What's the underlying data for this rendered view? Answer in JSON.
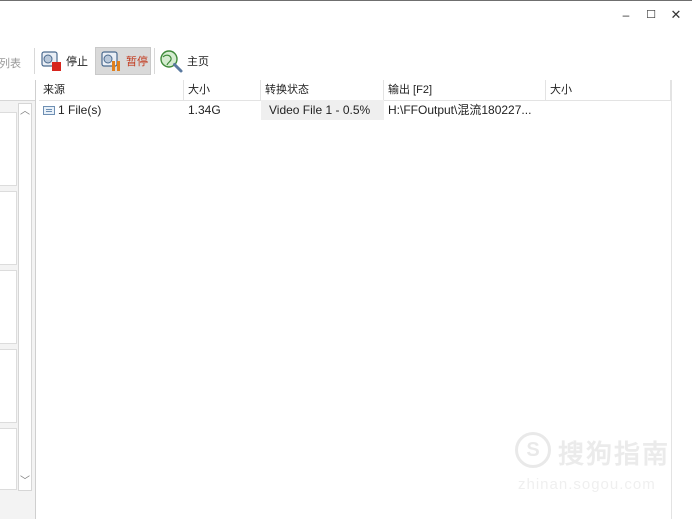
{
  "window": {
    "minimize_glyph": "–",
    "maximize_glyph": "☐",
    "close_glyph": "✕"
  },
  "toolbar": {
    "clipped_label": "全列表",
    "stop_label": "停止",
    "pause_label": "暂停",
    "home_label": "主页",
    "icons": [
      "stop-icon",
      "pause-icon",
      "home-icon"
    ]
  },
  "table": {
    "columns": [
      "来源",
      "大小",
      "转换状态",
      "输出 [F2]",
      "大小"
    ],
    "rows": [
      {
        "source": "1 File(s)",
        "size": "1.34G",
        "status": "Video File 1 - 0.5%",
        "output": "H:\\FFOutput\\混流180227..."
      }
    ]
  },
  "scrollbar": {
    "up_glyph": "︿",
    "down_glyph": "﹀"
  },
  "watermark": {
    "title": "搜狗指南",
    "url": "zhinan.sogou.com",
    "logo_glyph": "S"
  },
  "colors": {
    "active_label": "#c23a1e",
    "border": "#d6d6d6",
    "status_cell_bg": "#efefef"
  }
}
